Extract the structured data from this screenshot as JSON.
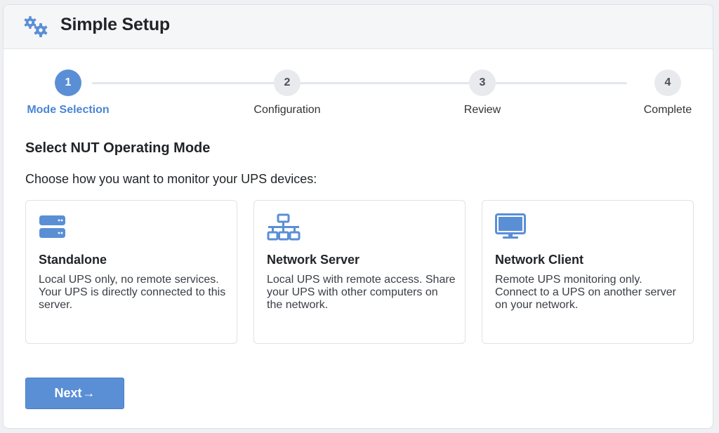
{
  "header": {
    "title": "Simple Setup",
    "icon": "gears-icon"
  },
  "steps": [
    {
      "number": "1",
      "label": "Mode Selection",
      "active": true
    },
    {
      "number": "2",
      "label": "Configuration",
      "active": false
    },
    {
      "number": "3",
      "label": "Review",
      "active": false
    },
    {
      "number": "4",
      "label": "Complete",
      "active": false
    }
  ],
  "main": {
    "heading": "Select NUT Operating Mode",
    "subtitle": "Choose how you want to monitor your UPS devices:",
    "cards": [
      {
        "icon": "server-icon",
        "title": "Standalone",
        "description": "Local UPS only, no remote services. Your UPS is directly connected to this server."
      },
      {
        "icon": "network-icon",
        "title": "Network Server",
        "description": "Local UPS with remote access. Share your UPS with other computers on the network."
      },
      {
        "icon": "desktop-icon",
        "title": "Network Client",
        "description": "Remote UPS monitoring only. Connect to a UPS on another server on your network."
      }
    ]
  },
  "footer": {
    "next_label": "Next",
    "next_icon": "arrow-right-icon"
  },
  "colors": {
    "accent": "#5a8fd6",
    "accent_text": "#4a86d4",
    "header_bg": "#f5f6f8",
    "step_inactive": "#e8eaee"
  }
}
